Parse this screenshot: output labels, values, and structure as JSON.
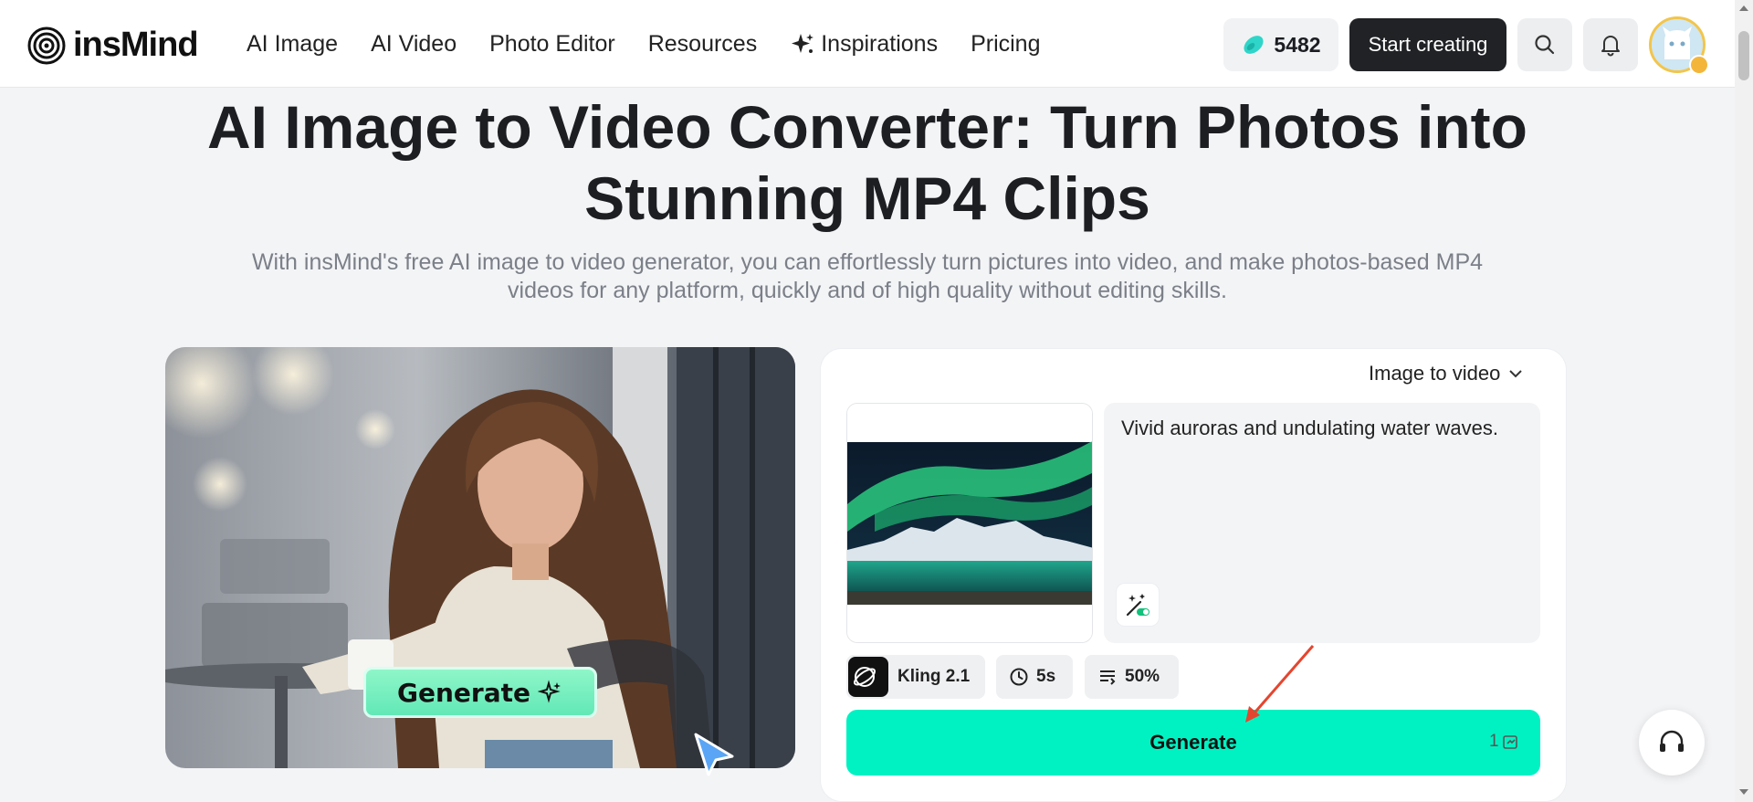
{
  "header": {
    "logo_text": "insMind",
    "nav": [
      "AI Image",
      "AI Video",
      "Photo Editor",
      "Resources",
      "Inspirations",
      "Pricing"
    ],
    "credits": "5482",
    "start_label": "Start creating"
  },
  "hero": {
    "title_line1": "AI Image to Video Converter: Turn Photos into",
    "title_line2": "Stunning MP4 Clips",
    "subtitle_line1": "With insMind's free AI image to video generator, you can effortlessly turn pictures into video, and make photos-based MP4",
    "subtitle_line2": "videos for any platform, quickly and of high quality without editing skills."
  },
  "sample": {
    "button_label": "Generate"
  },
  "panel": {
    "mode_label": "Image to video",
    "prompt": "Vivid auroras and undulating water waves.",
    "model": "Kling 2.1",
    "duration": "5s",
    "strength": "50%",
    "generate_label": "Generate",
    "cost": "1"
  },
  "colors": {
    "accent": "#00f2c3",
    "dark_button": "#202225",
    "background": "#f3f4f6"
  },
  "icons": [
    "insmind-logo-icon",
    "sparkle-icon",
    "credit-bean-icon",
    "search-icon",
    "bell-icon",
    "avatar-icon",
    "chevron-down-icon",
    "magic-enhance-icon",
    "kling-model-icon",
    "clock-icon",
    "list-settings-icon",
    "cost-icon",
    "headset-icon"
  ]
}
